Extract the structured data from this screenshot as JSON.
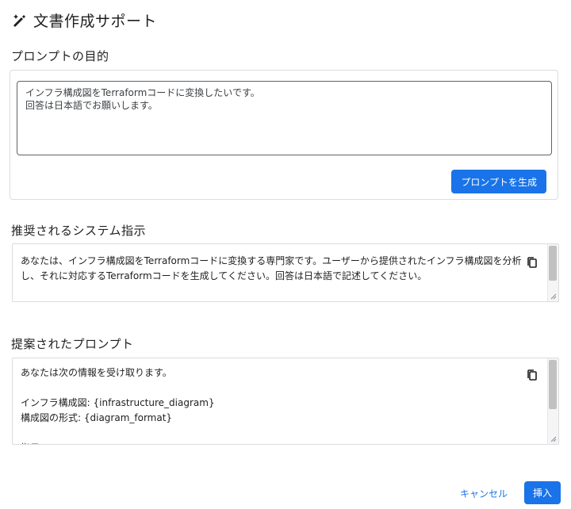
{
  "dialog": {
    "title": "文書作成サポート",
    "title_icon": "magic-pen-icon"
  },
  "purpose": {
    "heading": "プロンプトの目的",
    "value": "インフラ構成図をTerraformコードに変換したいです。\n回答は日本語でお願いします。",
    "generate_label": "プロンプトを生成"
  },
  "system_instruction": {
    "heading": "推奨されるシステム指示",
    "text": "あなたは、インフラ構成図をTerraformコードに変換する専門家です。ユーザーから提供されたインフラ構成図を分析し、それに対応するTerraformコードを生成してください。回答は日本語で記述してください。",
    "copy_icon": "copy-icon"
  },
  "suggested_prompt": {
    "heading": "提案されたプロンプト",
    "text": "あなたは次の情報を受け取ります。\n\nインフラ構成図: {infrastructure_diagram}\n構成図の形式: {diagram_format}\n\n指示",
    "copy_icon": "copy-icon"
  },
  "footer": {
    "cancel_label": "キャンセル",
    "insert_label": "挿入"
  },
  "colors": {
    "primary": "#1a73e8",
    "border": "#dadce0"
  }
}
